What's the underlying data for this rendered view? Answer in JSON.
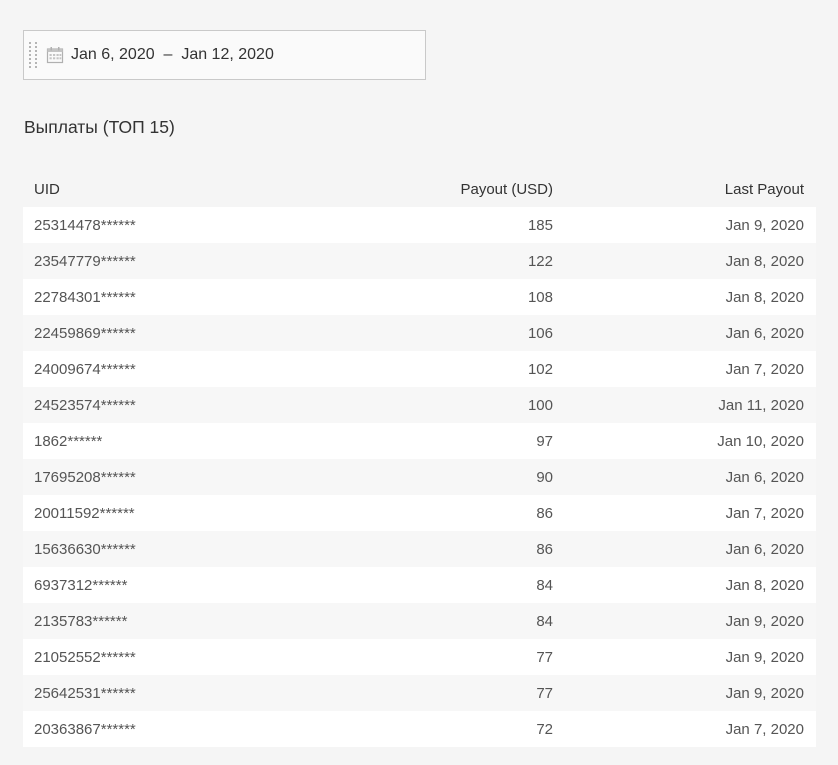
{
  "date_range": {
    "start": "Jan 6, 2020",
    "separator": "–",
    "end": "Jan 12, 2020",
    "icon": "calendar-icon"
  },
  "section_title": "Выплаты (ТОП 15)",
  "table": {
    "headers": {
      "uid": "UID",
      "payout": "Payout (USD)",
      "last_payout": "Last Payout"
    },
    "rows": [
      {
        "uid": "25314478******",
        "payout": "185",
        "last_payout": "Jan 9, 2020"
      },
      {
        "uid": "23547779******",
        "payout": "122",
        "last_payout": "Jan 8, 2020"
      },
      {
        "uid": "22784301******",
        "payout": "108",
        "last_payout": "Jan 8, 2020"
      },
      {
        "uid": "22459869******",
        "payout": "106",
        "last_payout": "Jan 6, 2020"
      },
      {
        "uid": "24009674******",
        "payout": "102",
        "last_payout": "Jan 7, 2020"
      },
      {
        "uid": "24523574******",
        "payout": "100",
        "last_payout": "Jan 11, 2020"
      },
      {
        "uid": "1862******",
        "payout": "97",
        "last_payout": "Jan 10, 2020"
      },
      {
        "uid": "17695208******",
        "payout": "90",
        "last_payout": "Jan 6, 2020"
      },
      {
        "uid": "20011592******",
        "payout": "86",
        "last_payout": "Jan 7, 2020"
      },
      {
        "uid": "15636630******",
        "payout": "86",
        "last_payout": "Jan 6, 2020"
      },
      {
        "uid": "6937312******",
        "payout": "84",
        "last_payout": "Jan 8, 2020"
      },
      {
        "uid": "2135783******",
        "payout": "84",
        "last_payout": "Jan 9, 2020"
      },
      {
        "uid": "21052552******",
        "payout": "77",
        "last_payout": "Jan 9, 2020"
      },
      {
        "uid": "25642531******",
        "payout": "77",
        "last_payout": "Jan 9, 2020"
      },
      {
        "uid": "20363867******",
        "payout": "72",
        "last_payout": "Jan 7, 2020"
      }
    ]
  }
}
